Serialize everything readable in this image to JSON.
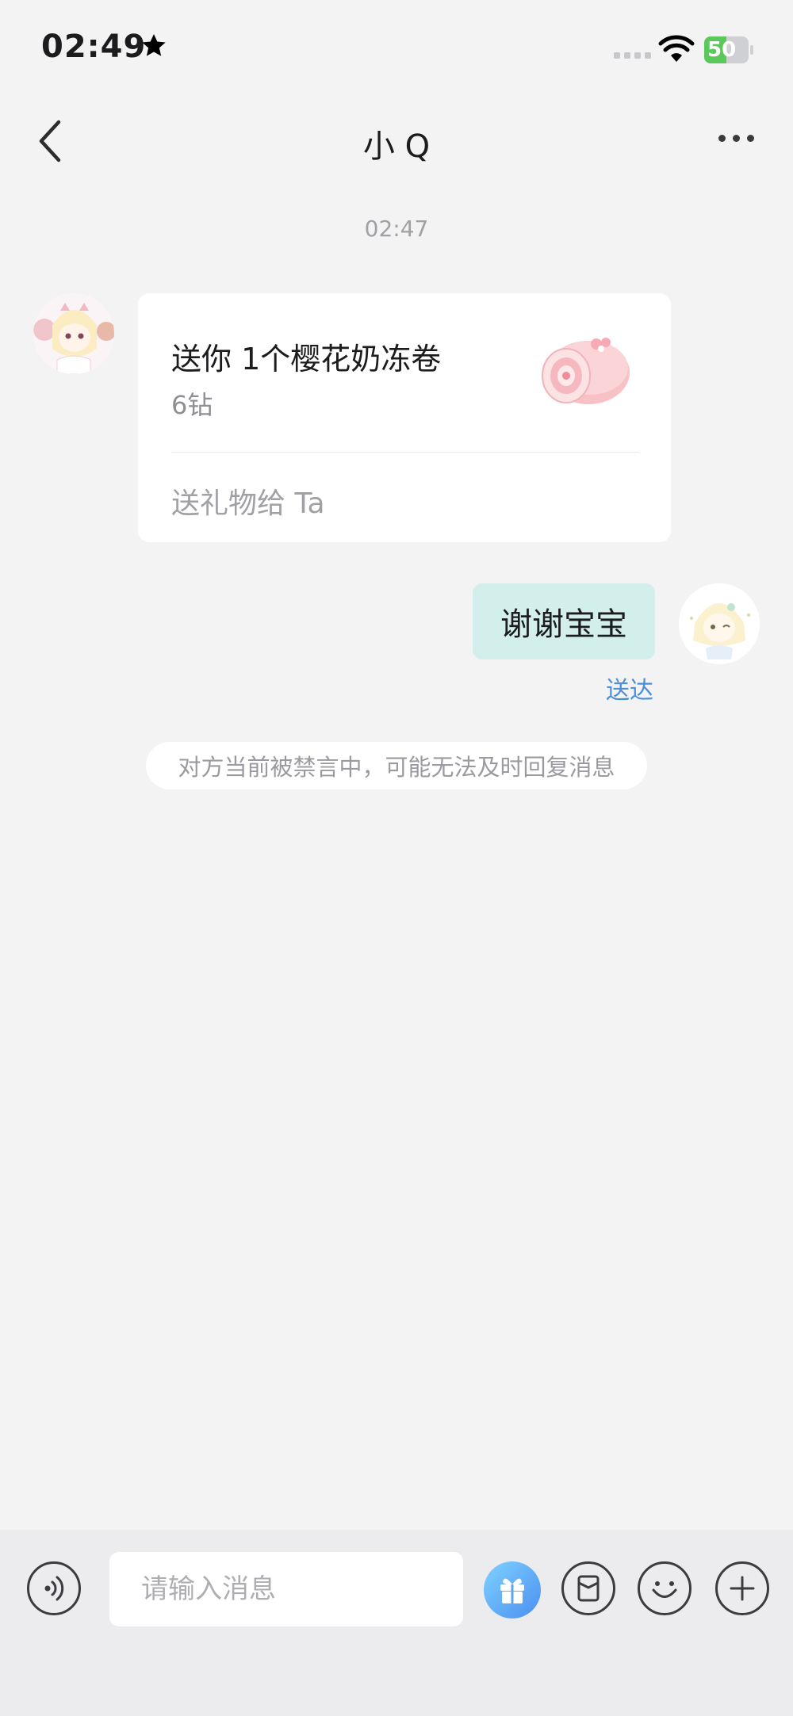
{
  "status_bar": {
    "time": "02:49",
    "battery_level": "50",
    "battery_fraction": 0.5,
    "icons": [
      "star-icon",
      "signal-icon",
      "wifi-icon",
      "battery-charging-icon"
    ]
  },
  "nav": {
    "title": "小 Q",
    "back_icon": "chevron-left-icon",
    "more_icon": "more-horizontal-icon"
  },
  "chat": {
    "timestamp": "02:47",
    "gift_message": {
      "title": "送你 1个樱花奶冻卷",
      "price": "6钻",
      "action": "送礼物给 Ta",
      "image": "sakura-roll-cake"
    },
    "my_message": {
      "text": "谢谢宝宝",
      "status": "送达"
    },
    "system_notice": "对方当前被禁言中，可能无法及时回复消息"
  },
  "input_bar": {
    "placeholder": "请输入消息",
    "value": "",
    "buttons": [
      "voice-icon",
      "gift-icon",
      "card-icon",
      "emoji-icon",
      "plus-icon"
    ]
  },
  "colors": {
    "background": "#f3f3f4",
    "bubble_mine": "#d3efec",
    "link_blue": "#4a8fd8",
    "gift_button_gradient": [
      "#7fd2ff",
      "#4b8ff0"
    ]
  }
}
